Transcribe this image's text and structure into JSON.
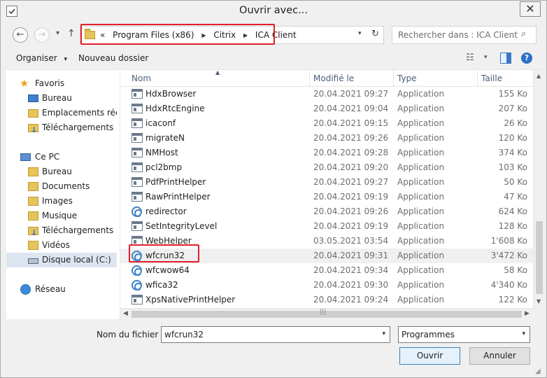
{
  "window": {
    "title": "Ouvrir avec...",
    "close_glyph": "✕"
  },
  "nav": {
    "back": "←",
    "forward": "→",
    "up": "↑",
    "recent": "▾"
  },
  "address": {
    "overflow": "«",
    "crumbs": [
      "Program Files (x86)",
      "Citrix",
      "ICA Client"
    ],
    "sep": "▶",
    "dropdown": "▾",
    "refresh": "↻"
  },
  "search": {
    "placeholder": "Rechercher dans : ICA Client",
    "icon": "⌕"
  },
  "toolbar": {
    "organize_label": "Organiser",
    "organize_arrow": "▾",
    "new_folder_label": "Nouveau dossier",
    "view_glyph": "☷",
    "view_arrow": "▾",
    "help_glyph": "?"
  },
  "sidebar": {
    "items": [
      {
        "label": "Favoris",
        "icon": "star-icon"
      },
      {
        "label": "Bureau",
        "icon": "desktop-icon"
      },
      {
        "label": "Emplacements récen",
        "icon": "recent-places-icon"
      },
      {
        "label": "Téléchargements",
        "icon": "downloads-folder-icon"
      },
      {
        "label": "Ce PC",
        "icon": "computer-icon"
      },
      {
        "label": "Bureau",
        "icon": "folder-icon"
      },
      {
        "label": "Documents",
        "icon": "folder-icon"
      },
      {
        "label": "Images",
        "icon": "folder-icon"
      },
      {
        "label": "Musique",
        "icon": "folder-icon"
      },
      {
        "label": "Téléchargements",
        "icon": "downloads-folder-icon"
      },
      {
        "label": "Vidéos",
        "icon": "folder-icon"
      },
      {
        "label": "Disque local (C:)",
        "icon": "drive-icon"
      },
      {
        "label": "Réseau",
        "icon": "network-icon"
      }
    ],
    "selected": "Disque local (C:)"
  },
  "columns": {
    "name": "Nom",
    "modified": "Modifié le",
    "type": "Type",
    "size": "Taille",
    "sort_glyph": "▲"
  },
  "files": [
    {
      "name": "HdxBrowser",
      "modified": "20.04.2021 09:27",
      "type": "Application",
      "size": "155 Ko",
      "icon": "app-icon"
    },
    {
      "name": "HdxRtcEngine",
      "modified": "20.04.2021 09:04",
      "type": "Application",
      "size": "207 Ko",
      "icon": "app-icon"
    },
    {
      "name": "icaconf",
      "modified": "20.04.2021 09:15",
      "type": "Application",
      "size": "26 Ko",
      "icon": "app-icon"
    },
    {
      "name": "migrateN",
      "modified": "20.04.2021 09:26",
      "type": "Application",
      "size": "120 Ko",
      "icon": "app-icon"
    },
    {
      "name": "NMHost",
      "modified": "20.04.2021 09:28",
      "type": "Application",
      "size": "374 Ko",
      "icon": "app-icon"
    },
    {
      "name": "pcl2bmp",
      "modified": "20.04.2021 09:20",
      "type": "Application",
      "size": "103 Ko",
      "icon": "app-icon"
    },
    {
      "name": "PdfPrintHelper",
      "modified": "20.04.2021 09:27",
      "type": "Application",
      "size": "50 Ko",
      "icon": "app-icon"
    },
    {
      "name": "RawPrintHelper",
      "modified": "20.04.2021 09:19",
      "type": "Application",
      "size": "47 Ko",
      "icon": "app-icon"
    },
    {
      "name": "redirector",
      "modified": "20.04.2021 09:26",
      "type": "Application",
      "size": "624 Ko",
      "icon": "citrix-icon"
    },
    {
      "name": "SetIntegrityLevel",
      "modified": "20.04.2021 09:19",
      "type": "Application",
      "size": "128 Ko",
      "icon": "app-icon"
    },
    {
      "name": "WebHelper",
      "modified": "03.05.2021 03:54",
      "type": "Application",
      "size": "1'608 Ko",
      "icon": "app-icon"
    },
    {
      "name": "wfcrun32",
      "modified": "20.04.2021 09:31",
      "type": "Application",
      "size": "3'472 Ko",
      "icon": "citrix-icon"
    },
    {
      "name": "wfcwow64",
      "modified": "20.04.2021 09:34",
      "type": "Application",
      "size": "58 Ko",
      "icon": "citrix-icon"
    },
    {
      "name": "wfica32",
      "modified": "20.04.2021 09:30",
      "type": "Application",
      "size": "4'340 Ko",
      "icon": "citrix-icon"
    },
    {
      "name": "XpsNativePrintHelper",
      "modified": "20.04.2021 09:24",
      "type": "Application",
      "size": "122 Ko",
      "icon": "app-icon"
    }
  ],
  "selected_file": "wfcrun32",
  "scroll": {
    "up": "▲",
    "down": "▼",
    "left": "◀",
    "right": "▶",
    "grip": "|||"
  },
  "bottom": {
    "filename_label": "Nom du fichier :",
    "filename_value": "wfcrun32",
    "filename_dropdown": "▾",
    "filetype_value": "Programmes",
    "filetype_dropdown": "▾",
    "open_label": "Ouvrir",
    "cancel_label": "Annuler"
  },
  "colors": {
    "highlight_red": "#e0202a",
    "accent_blue": "#2b6fc8",
    "header_text": "#4c607a"
  }
}
